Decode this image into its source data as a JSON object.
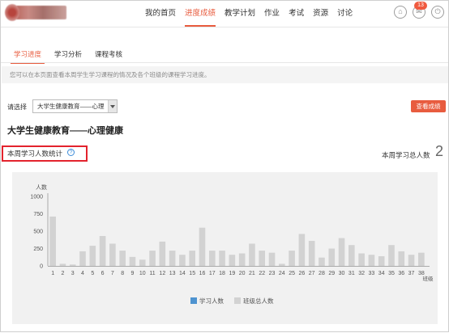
{
  "header": {
    "nav": [
      "我的首页",
      "进度成绩",
      "教学计划",
      "作业",
      "考试",
      "资源",
      "讨论"
    ],
    "active_nav": 1,
    "icons": [
      "home-icon",
      "mail-icon",
      "power-icon"
    ],
    "message_count": "13",
    "accent": "#e85c3f"
  },
  "tabs": [
    "学习进度",
    "学习分析",
    "课程考核"
  ],
  "active_tab": 0,
  "info_text": "您可以在本页面查看本周学生学习课程的情况及各个班级的课程学习进度。",
  "select": {
    "label": "请选择",
    "value": "大学生健康教育——心理"
  },
  "view_button": "查看成绩",
  "course_title": "大学生健康教育——心理健康",
  "stat_label": "本周学习人数统计",
  "help_icon": "question-circle-icon",
  "total": {
    "label": "本周学习总人数",
    "value": "2"
  },
  "chart_data": {
    "type": "bar",
    "ylabel": "人数",
    "xlabel": "班级",
    "ylim": [
      0,
      1000
    ],
    "yticks": [
      0,
      250,
      500,
      750,
      1000
    ],
    "categories": [
      "1",
      "2",
      "3",
      "4",
      "5",
      "6",
      "7",
      "8",
      "9",
      "10",
      "11",
      "12",
      "13",
      "14",
      "15",
      "16",
      "17",
      "18",
      "19",
      "20",
      "21",
      "22",
      "23",
      "24",
      "25",
      "26",
      "27",
      "28",
      "29",
      "30",
      "31",
      "32",
      "33",
      "34",
      "35",
      "36",
      "37",
      "38"
    ],
    "series": [
      {
        "name": "学习人数",
        "color": "#4e93d0",
        "values": [
          0,
          0,
          0,
          0,
          0,
          0,
          0,
          0,
          0,
          0,
          0,
          0,
          0,
          0,
          0,
          0,
          0,
          0,
          0,
          0,
          0,
          0,
          0,
          0,
          0,
          0,
          0,
          0,
          0,
          0,
          0,
          0,
          0,
          0,
          0,
          0,
          0,
          0
        ]
      },
      {
        "name": "班级总人数",
        "color": "#d2d2d2",
        "values": [
          710,
          30,
          20,
          210,
          290,
          430,
          320,
          220,
          130,
          90,
          220,
          350,
          220,
          160,
          220,
          550,
          220,
          220,
          160,
          180,
          320,
          220,
          190,
          30,
          220,
          460,
          360,
          120,
          250,
          400,
          300,
          180,
          160,
          140,
          300,
          210,
          160,
          190
        ]
      }
    ],
    "legend": "bottom-center",
    "grid": false
  }
}
